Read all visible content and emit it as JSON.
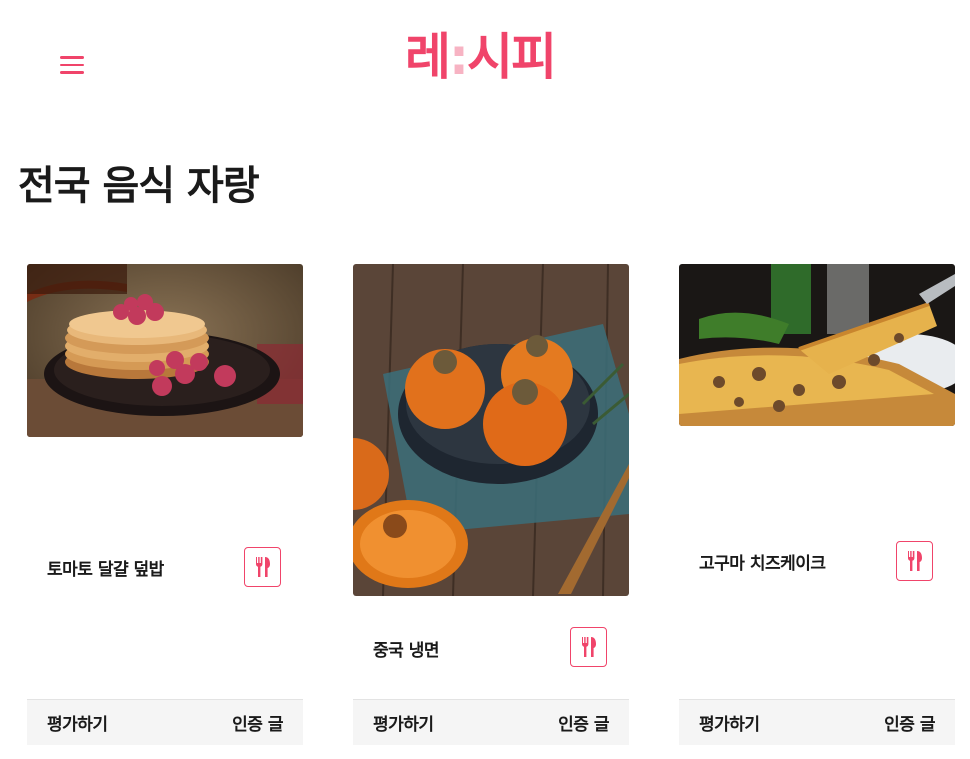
{
  "header": {
    "logo_main": "레",
    "logo_sep": ":",
    "logo_rest": "시피",
    "menu_icon": "hamburger-menu-icon"
  },
  "page": {
    "title": "전국 음식 자랑"
  },
  "cards": [
    {
      "name": "토마토 달걀 덮밥",
      "image": "pancakes-with-raspberries",
      "icon": "fork-knife-icon",
      "rate_label": "평가하기",
      "cert_label": "인증 글"
    },
    {
      "name": "중국 냉면",
      "image": "persimmons-in-bowl",
      "icon": "fork-knife-icon",
      "rate_label": "평가하기",
      "cert_label": "인증 글"
    },
    {
      "name": "고구마 치즈케이크",
      "image": "pizza-slice",
      "icon": "fork-knife-icon",
      "rate_label": "평가하기",
      "cert_label": "인증 글"
    }
  ],
  "colors": {
    "accent": "#f0446a",
    "footer_bg": "#f5f5f5"
  }
}
